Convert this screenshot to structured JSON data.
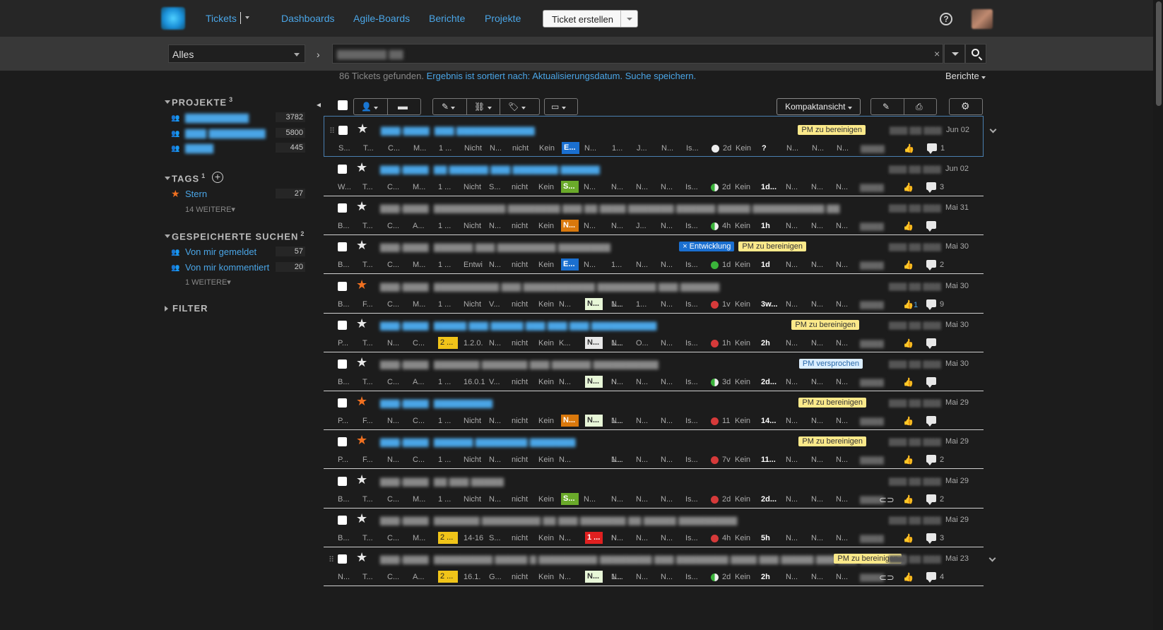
{
  "nav": {
    "tickets": "Tickets",
    "dashboards": "Dashboards",
    "agile": "Agile-Boards",
    "reports": "Berichte",
    "projects": "Projekte",
    "create": "Ticket erstellen"
  },
  "search": {
    "scope": "Alles",
    "clear": "×"
  },
  "results": {
    "count_text": "86 Tickets gefunden.",
    "sorted": "Ergebnis ist sortiert nach:",
    "sort_field": "Aktualisierungsdatum.",
    "save": "Suche speichern.",
    "reports": "Berichte"
  },
  "sidebar": {
    "projects": {
      "title": "PROJEKTE",
      "count": "3",
      "items": [
        {
          "count": "3782"
        },
        {
          "count": "5800"
        },
        {
          "count": "445"
        }
      ]
    },
    "tags": {
      "title": "TAGS",
      "count": "1",
      "items": [
        {
          "label": "Stern",
          "count": "27"
        }
      ],
      "more": "14 WEITERE"
    },
    "saved": {
      "title": "GESPEICHERTE SUCHEN",
      "count": "2",
      "items": [
        {
          "label": "Von mir gemeldet",
          "count": "57"
        },
        {
          "label": "Von mir kommentiert",
          "count": "20"
        }
      ],
      "more": "1 WEITERE"
    },
    "filter": {
      "title": "FILTER"
    }
  },
  "toolbar": {
    "view": "Kompaktansicht"
  },
  "tickets": [
    {
      "starred": false,
      "tags": [
        "PM zu bereinigen"
      ],
      "date": "Jun 02",
      "f1": "S...",
      "f2": "T...",
      "f3": "C...",
      "f4": "M...",
      "f5": "1 ...",
      "f6": "Nicht",
      "f7": "N...",
      "f8": "nicht",
      "f9": "Kein",
      "state": "E...",
      "state_color": "#1a6fd0",
      "f10": "N...",
      "f11": "1...",
      "f12": "J...",
      "f13": "N...",
      "f14": "Is...",
      "dot": "w",
      "age": "2d",
      "kein": "Kein",
      "est": "?",
      "n1": "N...",
      "n2": "N...",
      "n3": "N...",
      "likes": "",
      "comments": "1",
      "clip": false
    },
    {
      "starred": false,
      "tags": [],
      "date": "Jun 02",
      "f1": "W...",
      "f2": "T...",
      "f3": "C...",
      "f4": "M...",
      "f5": "1 ...",
      "f6": "Nicht",
      "f7": "S...",
      "f8": "nicht",
      "f9": "Kein",
      "state": "S...",
      "state_color": "#6aaa2a",
      "f10": "N...",
      "f11": "N...",
      "f12": "N...",
      "f13": "N...",
      "f14": "Is...",
      "dot": "h",
      "age": "2d",
      "kein": "Kein",
      "est": "1d...",
      "n1": "N...",
      "n2": "N...",
      "n3": "N...",
      "likes": "",
      "comments": "3",
      "clip": false
    },
    {
      "starred": false,
      "tags": [],
      "date": "Mai 31",
      "f1": "B...",
      "f2": "T...",
      "f3": "C...",
      "f4": "A...",
      "f5": "1 ...",
      "f6": "Nicht",
      "f7": "N...",
      "f8": "nicht",
      "f9": "Kein",
      "state": "N...",
      "state_color": "#d9780c",
      "f10": "N...",
      "f11": "N...",
      "f12": "J...",
      "f13": "N...",
      "f14": "Is...",
      "dot": "h",
      "age": "4h",
      "kein": "Kein",
      "est": "1h",
      "n1": "N...",
      "n2": "N...",
      "n3": "N...",
      "likes": "",
      "comments": "",
      "clip": false
    },
    {
      "starred": false,
      "tags": [
        "× Entwicklung",
        "PM zu bereinigen"
      ],
      "date": "Mai 30",
      "f1": "B...",
      "f2": "T...",
      "f3": "C...",
      "f4": "M...",
      "f5": "1 ...",
      "f6": "Entwi",
      "f7": "N...",
      "f8": "nicht",
      "f9": "Kein",
      "state": "E...",
      "state_color": "#1a6fd0",
      "f10": "N...",
      "f11": "1...",
      "f12": "N...",
      "f13": "N...",
      "f14": "Is...",
      "dot": "g",
      "age": "1d",
      "kein": "Kein",
      "est": "1d",
      "n1": "N...",
      "n2": "N...",
      "n3": "N...",
      "likes": "",
      "comments": "2",
      "clip": false
    },
    {
      "starred": true,
      "tags": [],
      "date": "Mai 30",
      "f1": "B...",
      "f2": "F...",
      "f3": "C...",
      "f4": "M...",
      "f5": "1 ...",
      "f6": "Nicht",
      "f7": "V...",
      "f8": "nicht",
      "f9": "Kein",
      "f9b": "N...",
      "state": "N...",
      "state_color": "#e8f7d8",
      "state_text": "#333",
      "f10": "1...",
      "f11": "N...",
      "f12": "1...",
      "f13": "N...",
      "f14": "Is...",
      "dot": "r",
      "age": "1v",
      "kein": "Kein",
      "est": "3w...",
      "n1": "N...",
      "n2": "N...",
      "n3": "N...",
      "likes": "1",
      "comments": "9",
      "clip": false
    },
    {
      "starred": false,
      "tags": [
        "PM zu bereinigen"
      ],
      "date": "Mai 30",
      "f1": "P...",
      "f2": "T...",
      "f3": "N...",
      "f4": "C...",
      "f5": "2 ...",
      "f5y": true,
      "f6": "1.2.0.",
      "f7": "N...",
      "f8": "nicht",
      "f9": "Kein",
      "f9b": "K...",
      "state": "N...",
      "state_color": "#e8e8e8",
      "state_text": "#333",
      "f10": "1...",
      "f11": "N...",
      "f12": "O...",
      "f13": "N...",
      "f14": "Is...",
      "dot": "r",
      "age": "1h",
      "kein": "Kein",
      "est": "2h",
      "n1": "N...",
      "n2": "N...",
      "n3": "N...",
      "likes": "",
      "likes_dim": true,
      "comments": "",
      "clip": false
    },
    {
      "starred": false,
      "tags": [
        "PM versprochen"
      ],
      "date": "Mai 30",
      "f1": "B...",
      "f2": "T...",
      "f3": "C...",
      "f4": "A...",
      "f5": "1 ...",
      "f6": "16.0.1",
      "f7": "V...",
      "f8": "nicht",
      "f9": "Kein",
      "f9b": "N...",
      "state": "N...",
      "state_color": "#e8f7d8",
      "state_text": "#333",
      "f10": "N...",
      "f11": "N...",
      "f12": "N...",
      "f13": "N...",
      "f14": "Is...",
      "dot": "h",
      "age": "3d",
      "kein": "Kein",
      "est": "2d...",
      "n1": "N...",
      "n2": "N...",
      "n3": "N...",
      "likes": "",
      "comments": "",
      "clip": false
    },
    {
      "starred": true,
      "tags": [
        "PM zu bereinigen"
      ],
      "date": "Mai 29",
      "f1": "P...",
      "f2": "F...",
      "f3": "N...",
      "f4": "C...",
      "f5": "1 ...",
      "f6": "Nicht",
      "f7": "N...",
      "f8": "nicht",
      "f9": "Kein",
      "state": "N...",
      "state_color": "#d9780c",
      "state2": "N...",
      "f10": "1...",
      "f11": "N...",
      "f12": "N...",
      "f13": "N...",
      "f14": "Is...",
      "dot": "r",
      "age": "11",
      "kein": "Kein",
      "est": "14...",
      "n1": "N...",
      "n2": "N...",
      "n3": "N...",
      "likes": "",
      "likes_dim": true,
      "comments": "",
      "clip": false
    },
    {
      "starred": true,
      "tags": [
        "PM zu bereinigen"
      ],
      "date": "Mai 29",
      "f1": "P...",
      "f2": "F...",
      "f3": "N...",
      "f4": "C...",
      "f5": "1 ...",
      "f6": "Nicht",
      "f7": "N...",
      "f8": "nicht",
      "f9": "Kein",
      "f9b": "N...",
      "state": "",
      "f10": "N...",
      "f11": "1...",
      "f12": "N...",
      "f13": "N...",
      "f14": "Is...",
      "dot": "r",
      "age": "7v",
      "kein": "Kein",
      "est": "11...",
      "n1": "N...",
      "n2": "N...",
      "n3": "N...",
      "likes": "",
      "comments": "2",
      "clip": false
    },
    {
      "starred": false,
      "tags": [],
      "date": "Mai 29",
      "f1": "B...",
      "f2": "T...",
      "f3": "C...",
      "f4": "M...",
      "f5": "1 ...",
      "f6": "Nicht",
      "f7": "N...",
      "f8": "nicht",
      "f9": "Kein",
      "state": "S...",
      "state_color": "#6aaa2a",
      "f10": "N...",
      "f11": "N...",
      "f12": "N...",
      "f13": "N...",
      "f14": "Is...",
      "dot": "r",
      "age": "2d",
      "kein": "Kein",
      "est": "2d...",
      "n1": "N...",
      "n2": "N...",
      "n3": "N...",
      "likes": "",
      "comments": "2",
      "clip": true
    },
    {
      "starred": false,
      "tags": [],
      "date": "Mai 29",
      "f1": "B...",
      "f2": "T...",
      "f3": "C...",
      "f4": "M...",
      "f5": "2 ...",
      "f5y": true,
      "f6": "14-16",
      "f7": "S...",
      "f8": "nicht",
      "f9": "Kein",
      "f9b": "N...",
      "state": "1 ...",
      "state_color": "#e02020",
      "f10": "N...",
      "f11": "N...",
      "f12": "N...",
      "f13": "N...",
      "f14": "Is...",
      "dot": "r",
      "age": "4h",
      "kein": "Kein",
      "est": "5h",
      "n1": "N...",
      "n2": "N...",
      "n3": "N...",
      "likes": "",
      "comments": "3",
      "clip": false
    },
    {
      "starred": false,
      "tags": [
        "PM zu bereinigen"
      ],
      "date": "Mai 23",
      "f1": "N...",
      "f2": "T...",
      "f3": "C...",
      "f4": "A...",
      "f5": "2 ...",
      "f5y": true,
      "f6": "16.1.",
      "f7": "G...",
      "f8": "nicht",
      "f9": "Kein",
      "f9b": "N...",
      "state": "N...",
      "state_color": "#e8f7d8",
      "state_text": "#333",
      "f10": "1...",
      "f11": "N...",
      "f12": "N...",
      "f13": "N...",
      "f14": "Is...",
      "dot": "h",
      "age": "2d",
      "kein": "Kein",
      "est": "2h",
      "n1": "N...",
      "n2": "N...",
      "n3": "N...",
      "likes": "",
      "comments": "4",
      "clip": true
    }
  ],
  "colors": {
    "accent": "#4aa5e6",
    "star_on": "#f07020",
    "tag_pm": "#fbe98a"
  }
}
